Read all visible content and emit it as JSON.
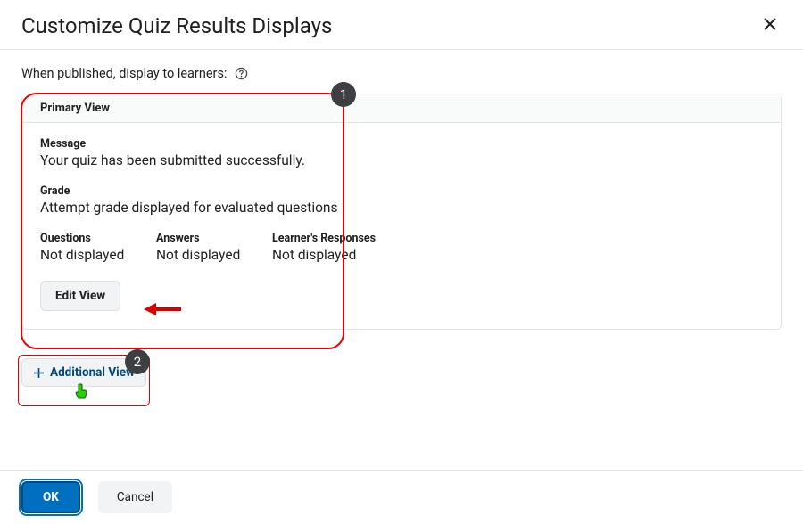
{
  "dialog": {
    "title": "Customize Quiz Results Displays",
    "intro": "When published, display to learners:"
  },
  "primary_view": {
    "header": "Primary View",
    "message_label": "Message",
    "message_value": "Your quiz has been submitted successfully.",
    "grade_label": "Grade",
    "grade_value": "Attempt grade displayed for evaluated questions",
    "cols": {
      "questions_label": "Questions",
      "questions_value": "Not displayed",
      "answers_label": "Answers",
      "answers_value": "Not displayed",
      "responses_label": "Learner's Responses",
      "responses_value": "Not displayed"
    },
    "edit_button": "Edit View"
  },
  "additional_view_button": "Additional View",
  "footer": {
    "ok": "OK",
    "cancel": "Cancel"
  },
  "annotations": {
    "step1": "1",
    "step2": "2"
  }
}
